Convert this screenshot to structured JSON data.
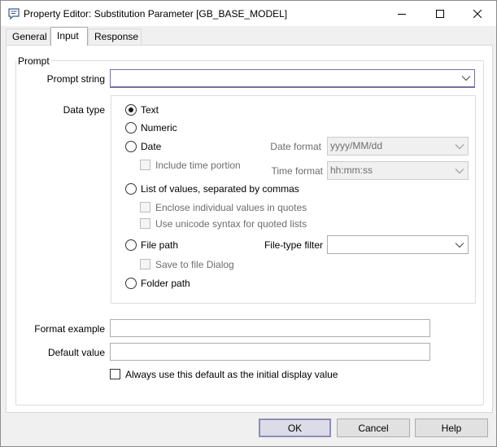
{
  "window": {
    "title": "Property Editor: Substitution Parameter [GB_BASE_MODEL]",
    "icon": "speech-bubble-icon"
  },
  "tabs": [
    {
      "label": "General",
      "active": false
    },
    {
      "label": "Input",
      "active": true
    },
    {
      "label": "Response",
      "active": false
    }
  ],
  "prompt_group": {
    "legend": "Prompt",
    "prompt_string_label": "Prompt string",
    "prompt_string_value": ""
  },
  "data_type": {
    "label": "Data type",
    "options": {
      "text": {
        "label": "Text",
        "checked": true
      },
      "numeric": {
        "label": "Numeric",
        "checked": false
      },
      "date": {
        "label": "Date",
        "checked": false
      },
      "list": {
        "label": "List of values, separated by commas",
        "checked": false
      },
      "file_path": {
        "label": "File path",
        "checked": false
      },
      "folder_path": {
        "label": "Folder path",
        "checked": false
      }
    },
    "include_time_portion": "Include time portion",
    "date_format_label": "Date format",
    "date_format_value": "yyyy/MM/dd",
    "time_format_label": "Time format",
    "time_format_value": "hh:mm:ss",
    "enclose_quotes": "Enclose individual values in quotes",
    "unicode_syntax": "Use unicode syntax for quoted lists",
    "file_type_filter_label": "File-type filter",
    "file_type_filter_value": "",
    "save_to_file_dialog": "Save to file Dialog"
  },
  "format_example": {
    "label": "Format example",
    "value": ""
  },
  "default_value": {
    "label": "Default value",
    "value": ""
  },
  "always_default": {
    "label": "Always use this default as the initial display value",
    "checked": false
  },
  "buttons": {
    "ok": "OK",
    "cancel": "Cancel",
    "help": "Help"
  },
  "colors": {
    "focus_border": "#7a6f9b",
    "default_button": "#dcdbe8"
  }
}
